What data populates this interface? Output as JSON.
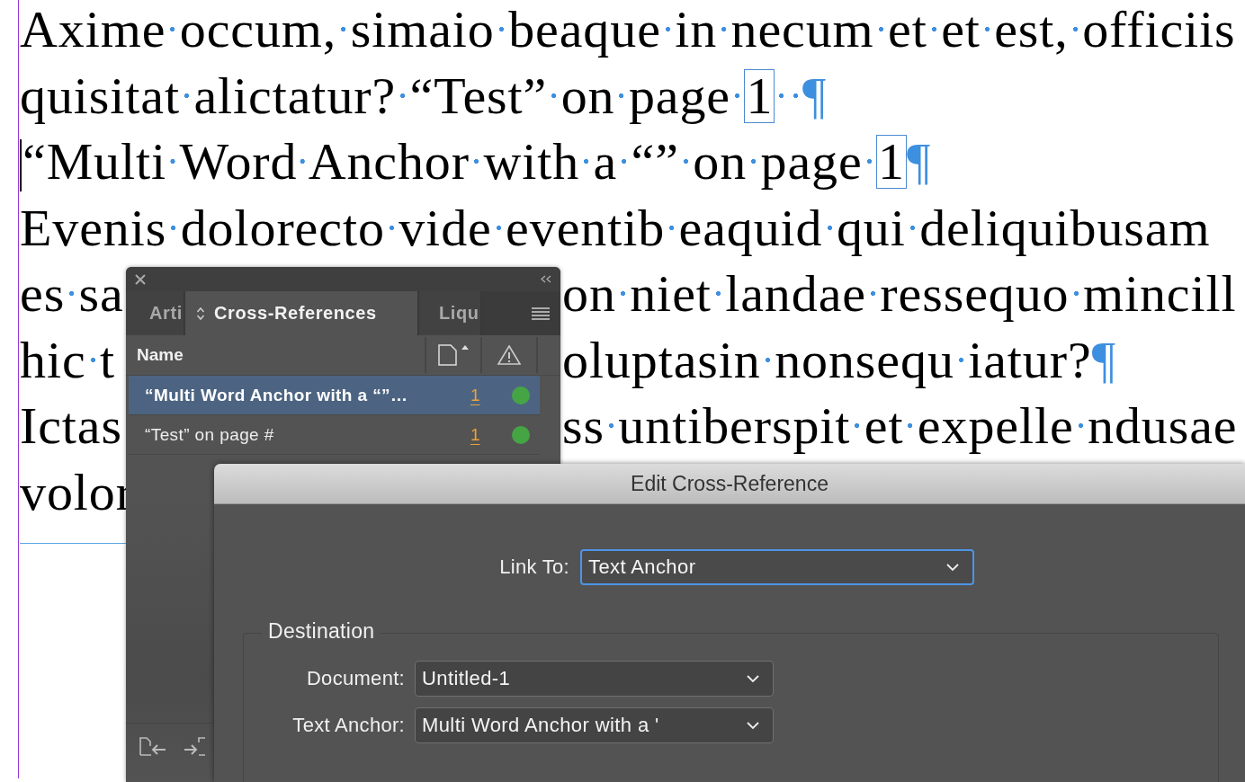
{
  "document": {
    "lines": [
      {
        "caret": false,
        "left": [
          {
            "kind": "text",
            "text": "Axime occum, simaio beaque in necum et et est, officiis"
          }
        ]
      },
      {
        "caret": false,
        "left": [
          {
            "kind": "text",
            "text": "quisitat alictatur? “Test” on page "
          },
          {
            "kind": "xref",
            "text": "1"
          },
          {
            "kind": "pilcrow",
            "text": "  ¶"
          }
        ]
      },
      {
        "caret": true,
        "left": [
          {
            "kind": "text",
            "text": "“Multi Word Anchor with a “” on page "
          },
          {
            "kind": "xref",
            "text": "1"
          },
          {
            "kind": "pilcrow",
            "text": "¶"
          }
        ]
      },
      {
        "caret": false,
        "left": [
          {
            "kind": "text",
            "text": "Evenis dolorecto vide eventib eaquid qui deliquibusam"
          }
        ]
      },
      {
        "caret": false,
        "left": [
          {
            "kind": "text",
            "text": "es sa"
          }
        ],
        "right": [
          {
            "kind": "text",
            "text": "on niet landae ressequo mincill"
          }
        ]
      },
      {
        "caret": false,
        "left": [
          {
            "kind": "text",
            "text": "hic t"
          }
        ],
        "right": [
          {
            "kind": "text",
            "text": "oluptasin nonsequ iatur?"
          },
          {
            "kind": "pilcrow",
            "text": "¶"
          }
        ]
      },
      {
        "caret": false,
        "left": [
          {
            "kind": "text",
            "text": "Ictas"
          }
        ],
        "right": [
          {
            "kind": "text",
            "text": "ss untiberspit et expelle ndusae"
          }
        ]
      },
      {
        "caret": false,
        "left": [
          {
            "kind": "text",
            "text": "volor"
          }
        ]
      }
    ]
  },
  "panel": {
    "tabs": [
      {
        "label": "Arti",
        "selected": false
      },
      {
        "label": "Cross-References",
        "selected": true
      },
      {
        "label": "Liqu",
        "selected": false
      }
    ],
    "columns": {
      "name": "Name"
    },
    "rows": [
      {
        "name": "“Multi Word Anchor with a “”…",
        "page": "1",
        "color": "#45a545",
        "selected": true
      },
      {
        "name": "“Test” on page #",
        "page": "1",
        "color": "#45a545",
        "selected": false
      }
    ]
  },
  "dialog": {
    "title": "Edit Cross-Reference",
    "link_to": {
      "label": "Link To:",
      "value": "Text Anchor",
      "focused": true
    },
    "destination": {
      "legend": "Destination",
      "fields": [
        {
          "label": "Document:",
          "value": "Untitled-1",
          "focused": false
        },
        {
          "label": "Text Anchor:",
          "value": "Multi Word Anchor with a '",
          "focused": false
        }
      ]
    }
  }
}
